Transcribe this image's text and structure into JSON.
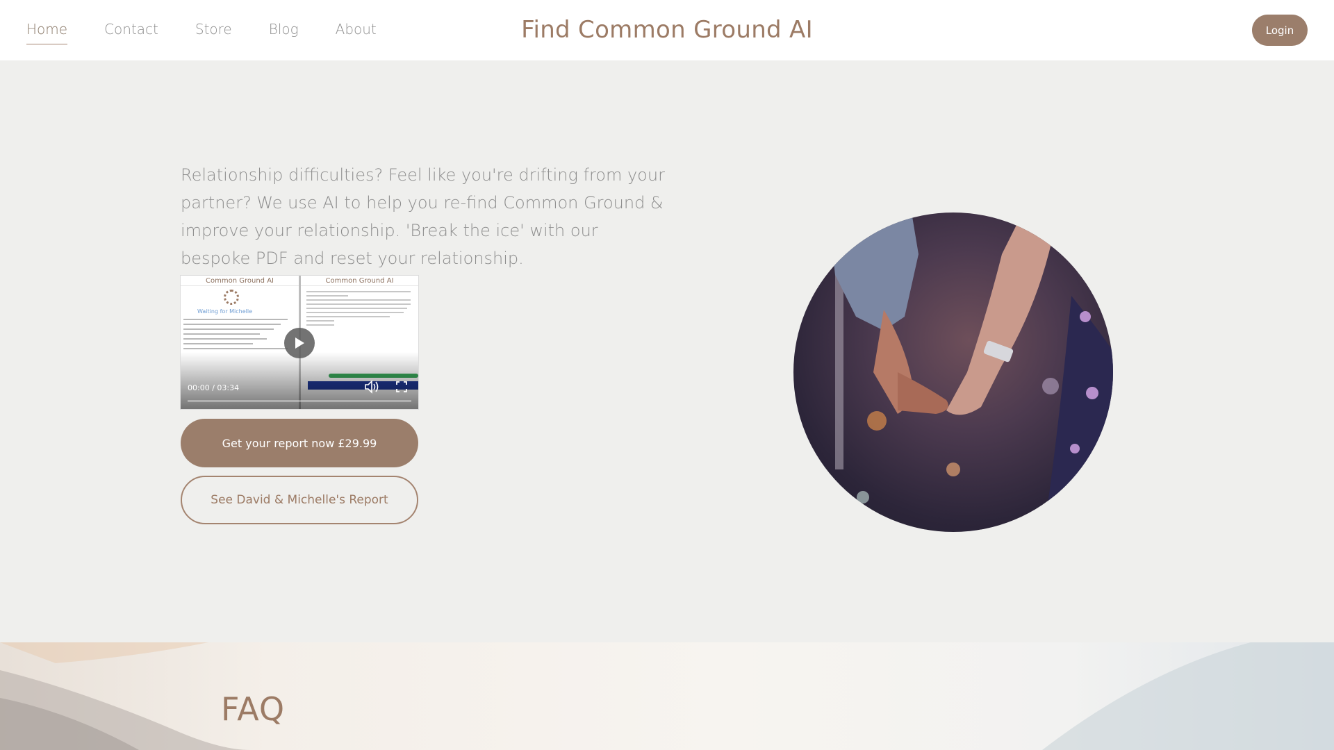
{
  "nav": {
    "items": [
      {
        "label": "Home",
        "active": true
      },
      {
        "label": "Contact"
      },
      {
        "label": "Store"
      },
      {
        "label": "Blog"
      },
      {
        "label": "About"
      }
    ],
    "site_title": "Find Common Ground AI",
    "login_label": "Login"
  },
  "hero": {
    "description": "Relationship difficulties? Feel like you're drifting from your partner? We use AI to help you re-find Common Ground & improve your relationship. 'Break the ice' with our bespoke PDF and reset your relationship.",
    "video": {
      "left_header": "Common Ground AI",
      "right_header": "Common Ground AI",
      "waiting_text": "Waiting for Michelle",
      "current_time": "00:00",
      "duration": "03:34",
      "progress": 0.0
    },
    "primary_button": "Get your report now £29.99",
    "secondary_button": "See David & Michelle's Report",
    "image_icon": "couple-holding-hands-photo"
  },
  "faq": {
    "title": "FAQ"
  },
  "colors": {
    "accent": "#9b7e6b",
    "background": "#efefed",
    "header": "#ffffff",
    "text": "#8d8d8d"
  }
}
